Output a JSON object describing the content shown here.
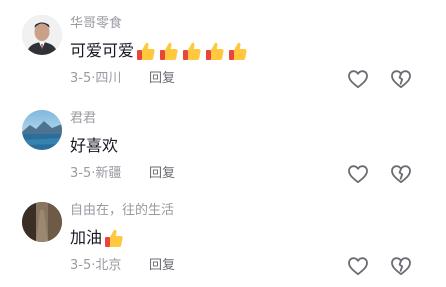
{
  "comments": [
    {
      "username": "华哥零食",
      "text": "可爱可爱",
      "thumbs": 5,
      "date": "3-5",
      "location": "四川",
      "reply_label": "回复"
    },
    {
      "username": "君君",
      "text": "好喜欢",
      "thumbs": 0,
      "date": "3-5",
      "location": "新疆",
      "reply_label": "回复"
    },
    {
      "username": "自由在，往的生活",
      "text": "加油",
      "thumbs": 1,
      "date": "3-5",
      "location": "北京",
      "reply_label": "回复"
    }
  ],
  "meta_separator": "·",
  "icons": {
    "like": "heart-outline-icon",
    "dislike": "broken-heart-outline-icon",
    "emoji": "thumbs-up-emoji-icon"
  },
  "colors": {
    "username": "#9a9aa2",
    "text": "#161823",
    "meta": "#9a9aa2",
    "reply": "#6b6b73",
    "icon": "#6b6b73",
    "emoji_yellow": "#ffc83d",
    "emoji_red": "#e8453c"
  }
}
